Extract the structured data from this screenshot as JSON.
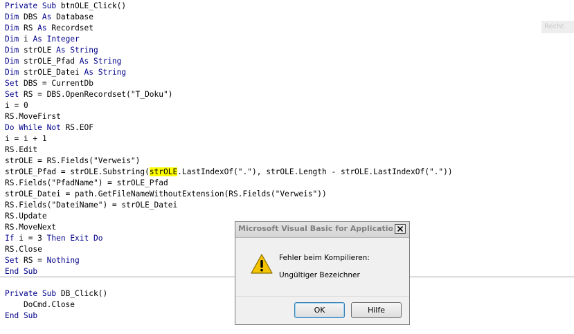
{
  "editor": {
    "lines": [
      {
        "parts": [
          {
            "t": "Private Sub ",
            "k": true
          },
          {
            "t": "btnOLE_Click()"
          }
        ]
      },
      {
        "parts": [
          {
            "t": "Dim ",
            "k": true
          },
          {
            "t": "DBS "
          },
          {
            "t": "As ",
            "k": true
          },
          {
            "t": "Database"
          }
        ]
      },
      {
        "parts": [
          {
            "t": "Dim ",
            "k": true
          },
          {
            "t": "RS "
          },
          {
            "t": "As ",
            "k": true
          },
          {
            "t": "Recordset"
          }
        ]
      },
      {
        "parts": [
          {
            "t": "Dim ",
            "k": true
          },
          {
            "t": "i "
          },
          {
            "t": "As Integer",
            "k": true
          }
        ]
      },
      {
        "parts": [
          {
            "t": "Dim ",
            "k": true
          },
          {
            "t": "strOLE "
          },
          {
            "t": "As String",
            "k": true
          }
        ]
      },
      {
        "parts": [
          {
            "t": "Dim ",
            "k": true
          },
          {
            "t": "strOLE_Pfad "
          },
          {
            "t": "As String",
            "k": true
          }
        ]
      },
      {
        "parts": [
          {
            "t": "Dim ",
            "k": true
          },
          {
            "t": "strOLE_Datei "
          },
          {
            "t": "As String",
            "k": true
          }
        ]
      },
      {
        "parts": [
          {
            "t": "Set ",
            "k": true
          },
          {
            "t": "DBS = CurrentDb"
          }
        ]
      },
      {
        "parts": [
          {
            "t": "Set ",
            "k": true
          },
          {
            "t": "RS = DBS.OpenRecordset(\"T_Doku\")"
          }
        ]
      },
      {
        "parts": [
          {
            "t": "i = 0"
          }
        ]
      },
      {
        "parts": [
          {
            "t": "RS.MoveFirst"
          }
        ]
      },
      {
        "parts": [
          {
            "t": "Do While Not ",
            "k": true
          },
          {
            "t": "RS.EOF"
          }
        ]
      },
      {
        "parts": [
          {
            "t": "i = i + 1"
          }
        ]
      },
      {
        "parts": [
          {
            "t": "RS.Edit"
          }
        ]
      },
      {
        "parts": [
          {
            "t": "strOLE = RS.Fields(\"Verweis\")"
          }
        ]
      },
      {
        "parts": [
          {
            "t": "strOLE_Pfad = strOLE.Substring("
          },
          {
            "t": "strOLE",
            "h": true
          },
          {
            "t": ".LastIndexOf(\".\"), strOLE.Length - strOLE.LastIndexOf(\".\"))"
          }
        ]
      },
      {
        "parts": [
          {
            "t": "RS.Fields(\"PfadName\") = strOLE_Pfad"
          }
        ]
      },
      {
        "parts": [
          {
            "t": "strOLE_Datei = path.GetFileNameWithoutExtension(RS.Fields(\"Verweis\"))"
          }
        ]
      },
      {
        "parts": [
          {
            "t": "RS.Fields(\"DateiName\") = strOLE_Datei"
          }
        ]
      },
      {
        "parts": [
          {
            "t": "RS.Update"
          }
        ]
      },
      {
        "parts": [
          {
            "t": "RS.MoveNext"
          }
        ]
      },
      {
        "parts": [
          {
            "t": "If ",
            "k": true
          },
          {
            "t": "i = 3 "
          },
          {
            "t": "Then Exit Do",
            "k": true
          }
        ]
      },
      {
        "parts": [
          {
            "t": "RS.Close"
          }
        ]
      },
      {
        "parts": [
          {
            "t": "Set ",
            "k": true
          },
          {
            "t": "RS = "
          },
          {
            "t": "Nothing",
            "k": true
          }
        ]
      },
      {
        "parts": [
          {
            "t": "End Sub",
            "k": true
          }
        ]
      },
      {
        "parts": []
      },
      {
        "parts": [
          {
            "t": "Private Sub ",
            "k": true
          },
          {
            "t": "DB_Click()"
          }
        ]
      },
      {
        "parts": [
          {
            "t": "    DoCmd.Close"
          }
        ]
      },
      {
        "parts": [
          {
            "t": "End Sub",
            "k": true
          }
        ]
      }
    ]
  },
  "side_label": "Recht",
  "dialog": {
    "title": "Microsoft Visual Basic for Applications",
    "message_line1": "Fehler beim Kompilieren:",
    "message_line2": "Ungültiger Bezeichner",
    "ok_label": "OK",
    "help_label": "Hilfe",
    "icon": "warning-icon",
    "close_icon": "close-icon"
  },
  "colors": {
    "keyword": "#00008b",
    "highlight": "#ffff00",
    "warning": "#f5c400"
  }
}
